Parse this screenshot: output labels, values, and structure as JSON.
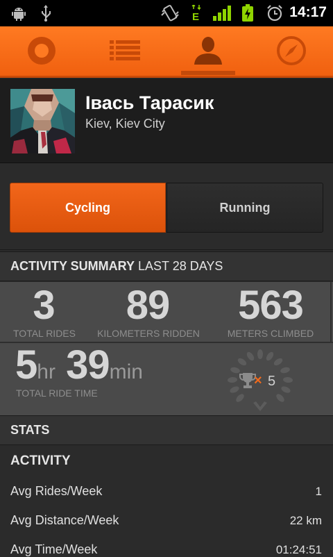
{
  "status_bar": {
    "time": "14:17",
    "network": "E",
    "icons": [
      "android-debug-icon",
      "usb-icon",
      "vibrate-icon",
      "network-type-icon",
      "signal-icon",
      "battery-charging-icon",
      "alarm-icon"
    ]
  },
  "tabs": [
    {
      "name": "record-tab",
      "icon": "record-icon"
    },
    {
      "name": "feed-tab",
      "icon": "list-icon"
    },
    {
      "name": "profile-tab",
      "icon": "profile-icon",
      "selected": true
    },
    {
      "name": "explore-tab",
      "icon": "compass-icon"
    }
  ],
  "profile": {
    "name": "Івась Тарасик",
    "location": "Kiev, Kiev City"
  },
  "sport_toggle": {
    "options": [
      "Cycling",
      "Running"
    ],
    "selected": "Cycling"
  },
  "activity_summary": {
    "title": "ACTIVITY SUMMARY",
    "period": "LAST 28 DAYS",
    "total_rides": {
      "value": "3",
      "label": "TOTAL RIDES"
    },
    "kilometers": {
      "value": "89",
      "label": "KILOMETERS RIDDEN"
    },
    "meters_climbed": {
      "value": "563",
      "label": "METERS CLIMBED"
    },
    "ride_time": {
      "hours": "5",
      "hours_unit": "hr",
      "minutes": "39",
      "minutes_unit": "min",
      "label": "TOTAL RIDE TIME"
    },
    "achievements": {
      "prefix": "×",
      "count": "5"
    }
  },
  "stats": {
    "header": "STATS",
    "activity_title": "ACTIVITY",
    "rows": [
      {
        "label": "Avg Rides/Week",
        "value": "1"
      },
      {
        "label": "Avg Distance/Week",
        "value": "22 km"
      },
      {
        "label": "Avg Time/Week",
        "value": "01:24:51"
      }
    ]
  },
  "colors": {
    "accent": "#f26a1b",
    "background": "#2b2b2b",
    "summary_bg": "#4a4a4a"
  }
}
